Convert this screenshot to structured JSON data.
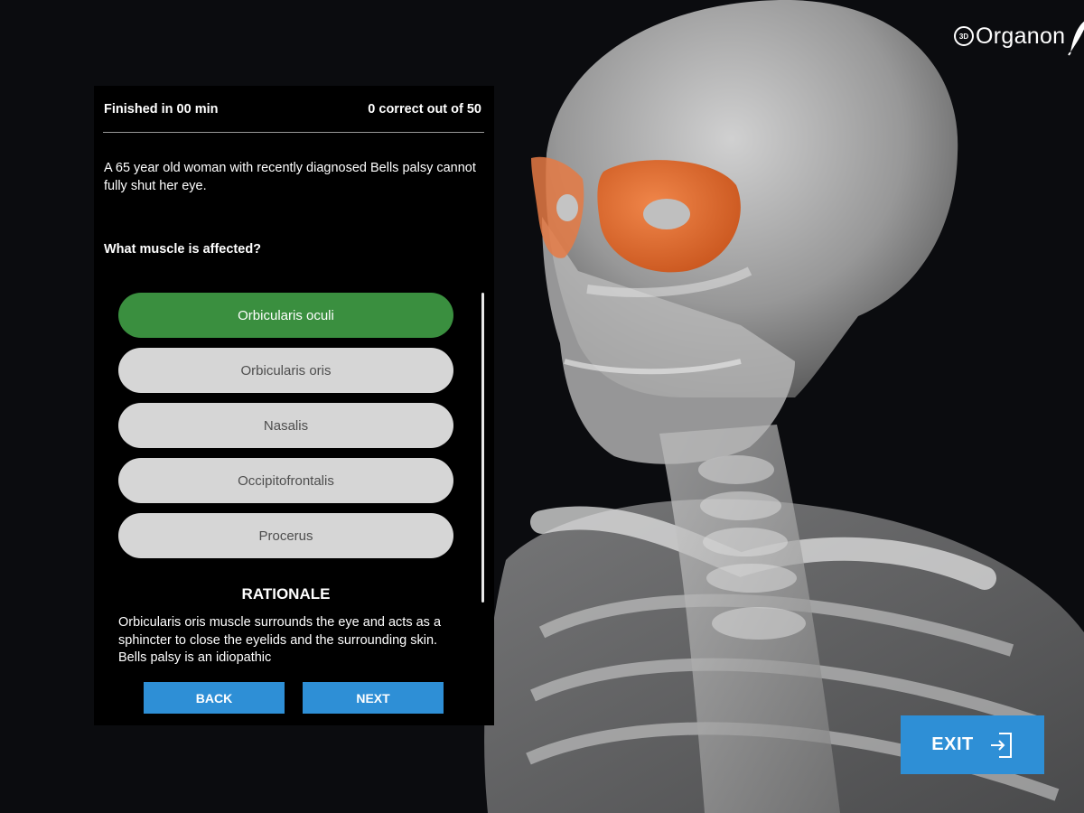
{
  "app": {
    "logo_text": "Organon",
    "logo_badge": "3D"
  },
  "quiz": {
    "timer": "Finished in 00 min",
    "score": "0 correct out of 50",
    "question": "A 65 year old woman with recently diagnosed Bells palsy cannot fully shut her eye.",
    "prompt": "What muscle is affected?",
    "answers": [
      {
        "label": "Orbicularis oculi",
        "state": "correct"
      },
      {
        "label": "Orbicularis oris",
        "state": "default"
      },
      {
        "label": "Nasalis",
        "state": "default"
      },
      {
        "label": "Occipitofrontalis",
        "state": "default"
      },
      {
        "label": "Procerus",
        "state": "default"
      }
    ],
    "rationale_heading": "RATIONALE",
    "rationale_text": "Orbicularis oris muscle surrounds the eye and acts as a sphincter to close the eyelids and the surrounding skin. Bells palsy is an idiopathic",
    "back_label": "BACK",
    "next_label": "NEXT"
  },
  "exit_label": "EXIT",
  "colors": {
    "background": "#0b0c0f",
    "panel": "#000000",
    "accent_blue": "#2e8fd6",
    "correct_green": "#3a8f3f",
    "answer_default": "#d6d6d6",
    "highlight_muscle": "#e0662a"
  },
  "icons": {
    "exit": "exit-door-arrow-icon",
    "logo": "quill-icon"
  }
}
